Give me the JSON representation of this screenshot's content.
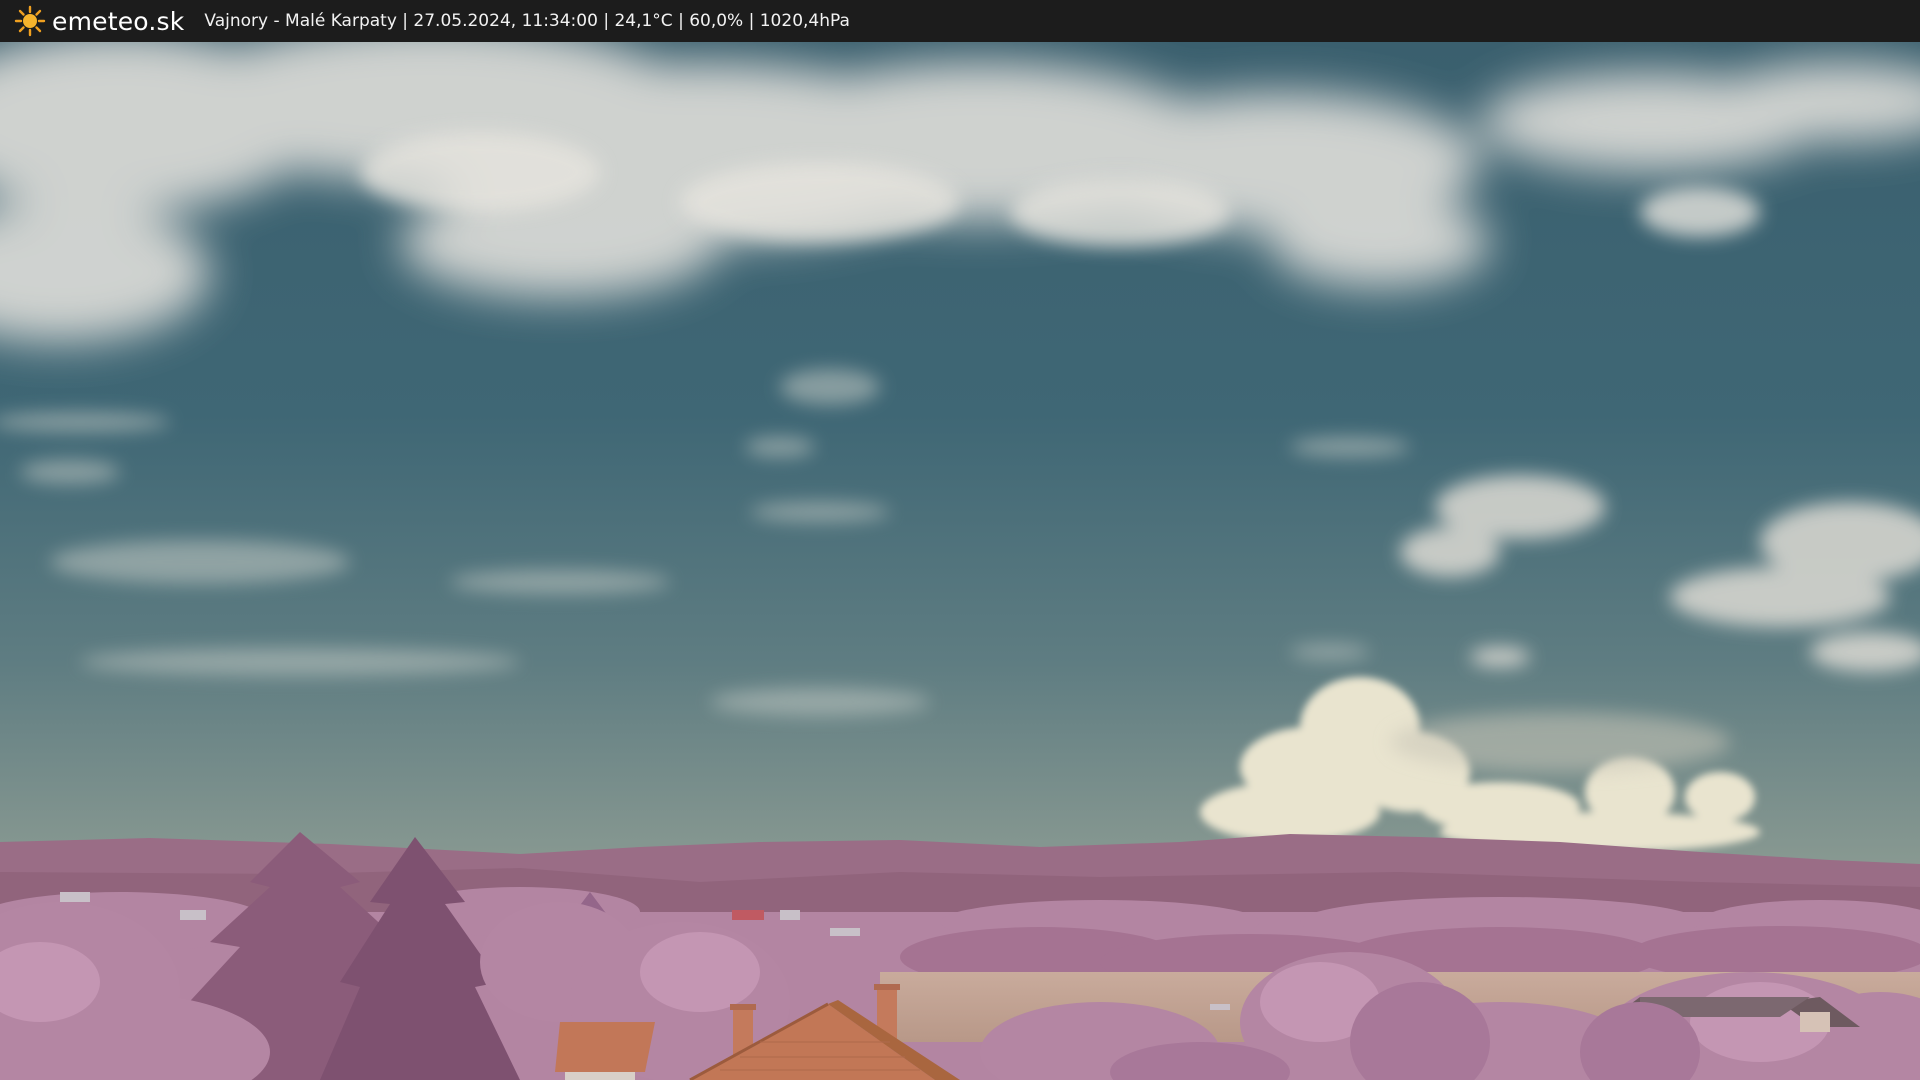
{
  "header": {
    "brand": "emeteo.sk",
    "logo_icon": "sun-icon",
    "info": "Vajnory - Malé Karpaty | 27.05.2024, 11:34:00 | 24,1°C | 60,0% | 1020,4hPa"
  },
  "colors": {
    "bar_background": "#1c1c1c",
    "sun": "#f0a020",
    "sky_top": "#39606e",
    "sky_horizon": "#7c9490",
    "hills": "#9c6e86",
    "foliage": "#b98aa8",
    "roof": "#c47a5c",
    "field": "#c4a89a"
  }
}
